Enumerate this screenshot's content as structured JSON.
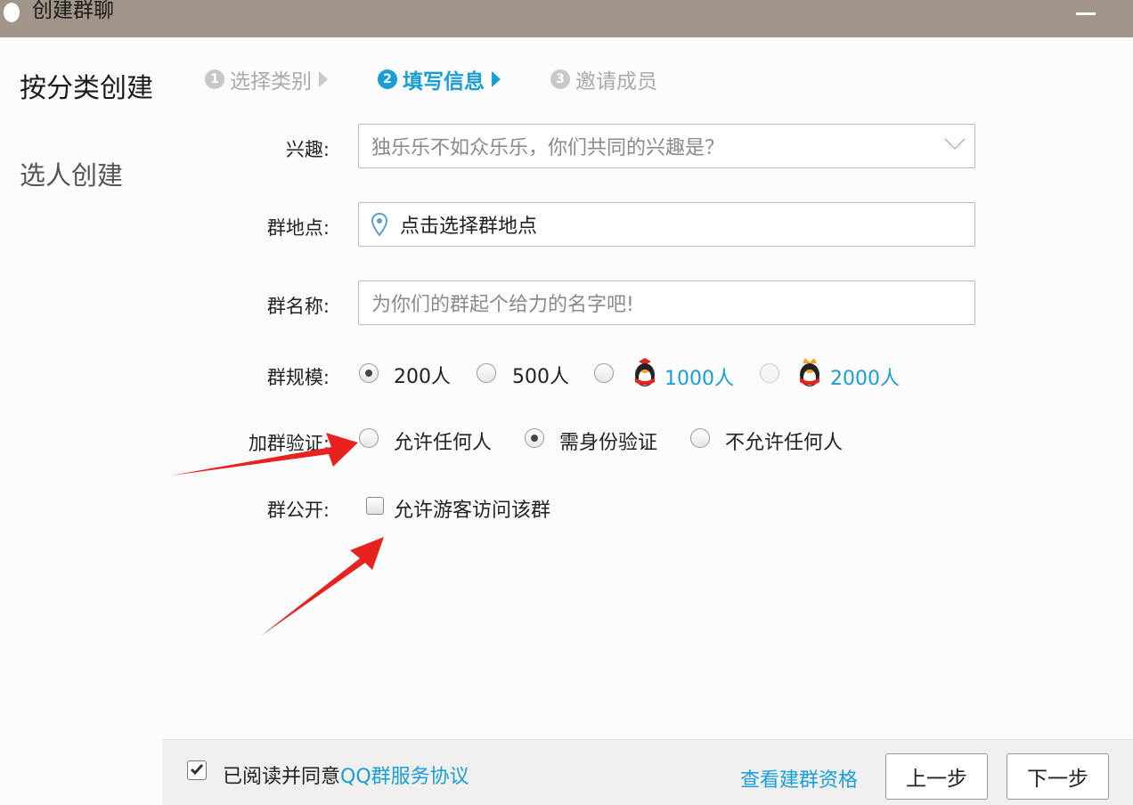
{
  "window": {
    "title": "创建群聊"
  },
  "sidebar": {
    "items": [
      {
        "label": "按分类创建"
      },
      {
        "label": "选人创建"
      }
    ]
  },
  "steps": [
    {
      "num": "1",
      "label": "选择类别"
    },
    {
      "num": "2",
      "label": "填写信息"
    },
    {
      "num": "3",
      "label": "邀请成员"
    }
  ],
  "form": {
    "interest": {
      "label": "兴趣:",
      "placeholder": "独乐乐不如众乐乐，你们共同的兴趣是？"
    },
    "location": {
      "label": "群地点:",
      "value": "点击选择群地点"
    },
    "name": {
      "label": "群名称:",
      "placeholder": "为你们的群起个给力的名字吧!"
    },
    "size": {
      "label": "群规模:",
      "options": [
        "200人",
        "500人",
        "1000人",
        "2000人"
      ],
      "selected": "200人"
    },
    "verify": {
      "label": "加群验证:",
      "options": [
        "允许任何人",
        "需身份验证",
        "不允许任何人"
      ],
      "selected": "需身份验证"
    },
    "public": {
      "label": "群公开:",
      "checkbox_label": "允许游客访问该群",
      "checked": false
    }
  },
  "footer": {
    "agree_prefix": "已阅读并同意",
    "agree_link": "QQ群服务协议",
    "agreed": true,
    "qualification_link": "查看建群资格",
    "prev_button": "上一步",
    "next_button": "下一步"
  },
  "colors": {
    "titlebar": "#a09588",
    "accent": "#1a9ed7",
    "annotation_arrow": "#e8231f"
  }
}
